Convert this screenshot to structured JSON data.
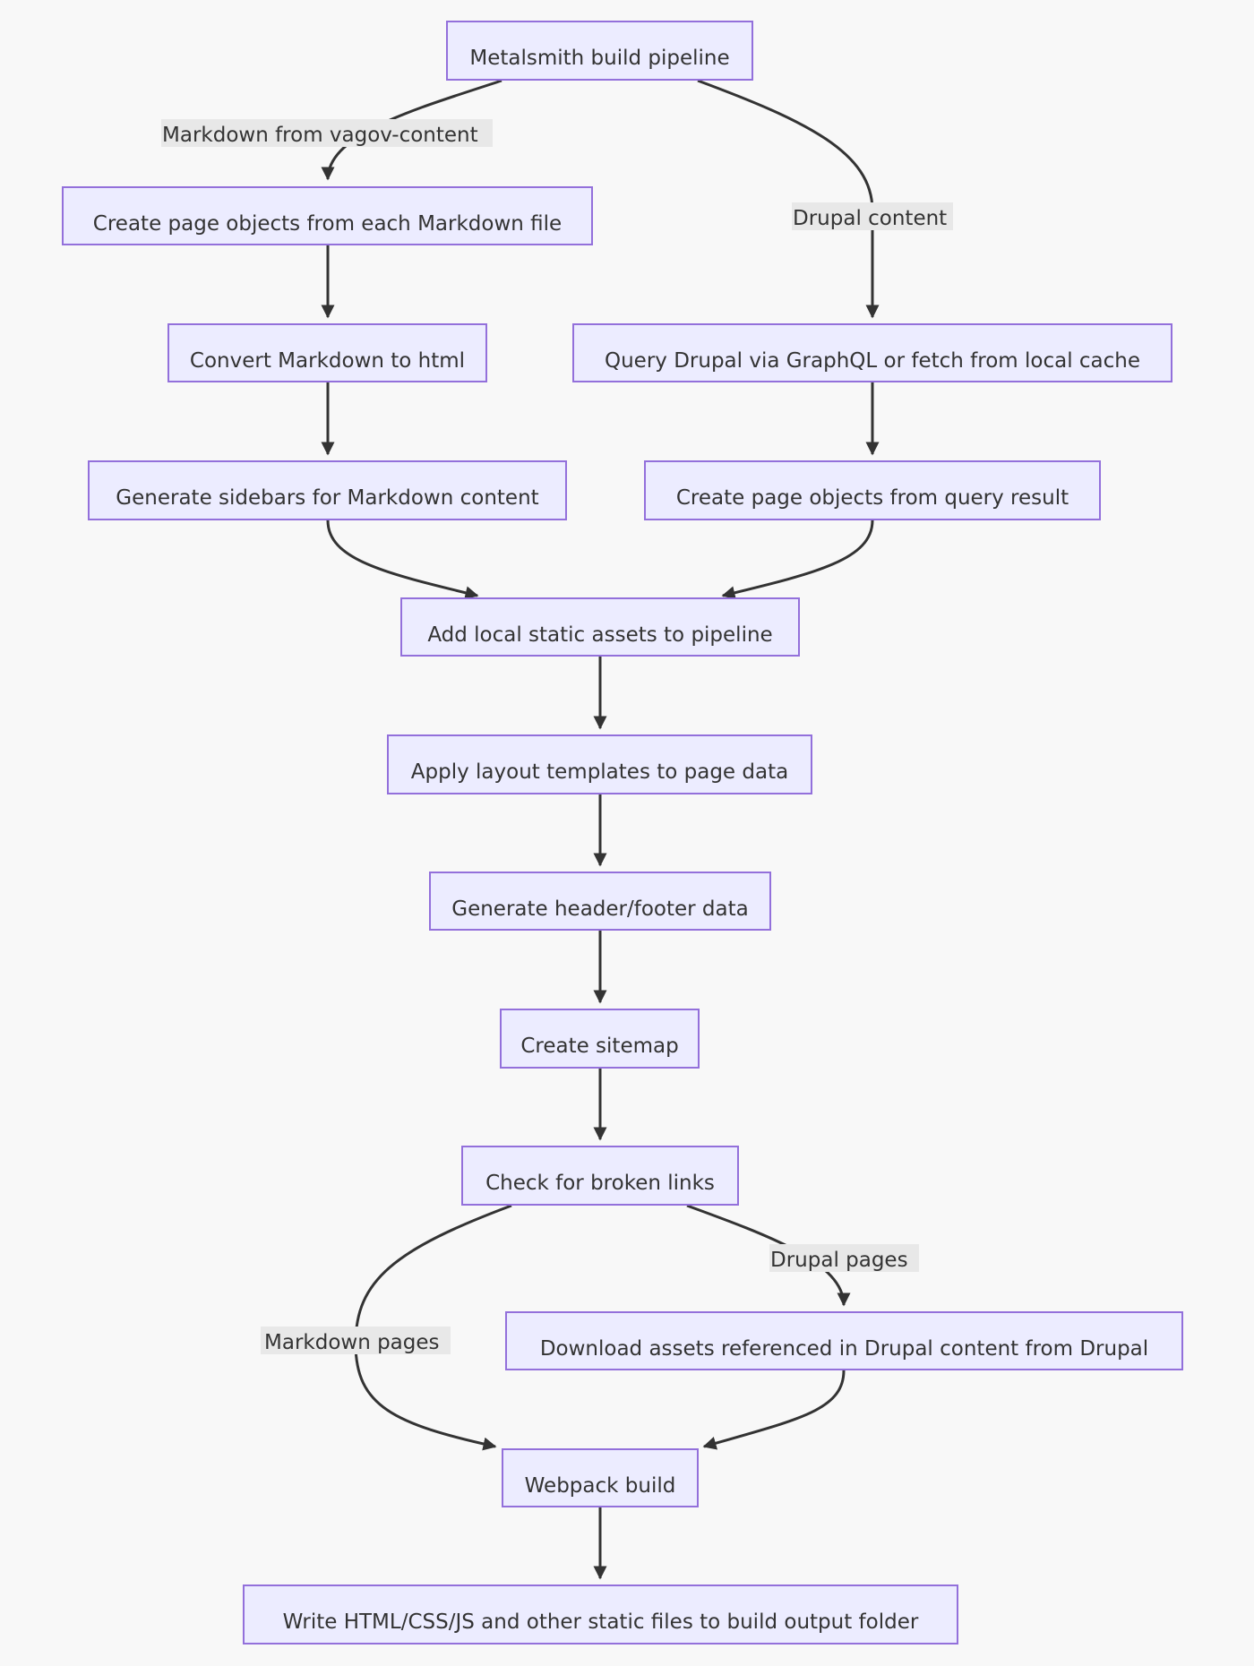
{
  "diagram": {
    "type": "flowchart",
    "direction": "top-down",
    "colors": {
      "background": "#f8f8f8",
      "node_fill": "#ececff",
      "node_stroke": "#9370db",
      "edge_stroke": "#333333",
      "edge_label_bg": "#e8e8e8",
      "text": "#333333"
    },
    "nodes": {
      "metalsmith": "Metalsmith build pipeline",
      "md_create": "Create page objects from each Markdown file",
      "convert": "Convert Markdown to html",
      "sidebars": "Generate sidebars for Markdown content",
      "query": "Query Drupal via GraphQL or fetch from local cache",
      "query_create": "Create page objects from query result",
      "add_assets": "Add local static assets to pipeline",
      "apply_layout": "Apply layout templates to page data",
      "header_footer": "Generate header/footer data",
      "sitemap": "Create sitemap",
      "check_links": "Check for broken links",
      "download": "Download assets referenced in Drupal content from Drupal",
      "webpack": "Webpack build",
      "write": "Write HTML/CSS/JS and other static files to build output folder"
    },
    "edge_labels": {
      "markdown_from_vagov": "Markdown from vagov-content",
      "drupal_content": "Drupal content",
      "drupal_pages": "Drupal pages",
      "markdown_pages": "Markdown pages"
    },
    "edges": [
      {
        "from": "metalsmith",
        "to": "md_create",
        "label": "Markdown from vagov-content"
      },
      {
        "from": "metalsmith",
        "to": "query",
        "label": "Drupal content"
      },
      {
        "from": "md_create",
        "to": "convert",
        "label": ""
      },
      {
        "from": "convert",
        "to": "sidebars",
        "label": ""
      },
      {
        "from": "query",
        "to": "query_create",
        "label": ""
      },
      {
        "from": "sidebars",
        "to": "add_assets",
        "label": ""
      },
      {
        "from": "query_create",
        "to": "add_assets",
        "label": ""
      },
      {
        "from": "add_assets",
        "to": "apply_layout",
        "label": ""
      },
      {
        "from": "apply_layout",
        "to": "header_footer",
        "label": ""
      },
      {
        "from": "header_footer",
        "to": "sitemap",
        "label": ""
      },
      {
        "from": "sitemap",
        "to": "check_links",
        "label": ""
      },
      {
        "from": "check_links",
        "to": "download",
        "label": "Drupal pages"
      },
      {
        "from": "check_links",
        "to": "webpack",
        "label": "Markdown pages"
      },
      {
        "from": "download",
        "to": "webpack",
        "label": ""
      },
      {
        "from": "webpack",
        "to": "write",
        "label": ""
      }
    ]
  }
}
